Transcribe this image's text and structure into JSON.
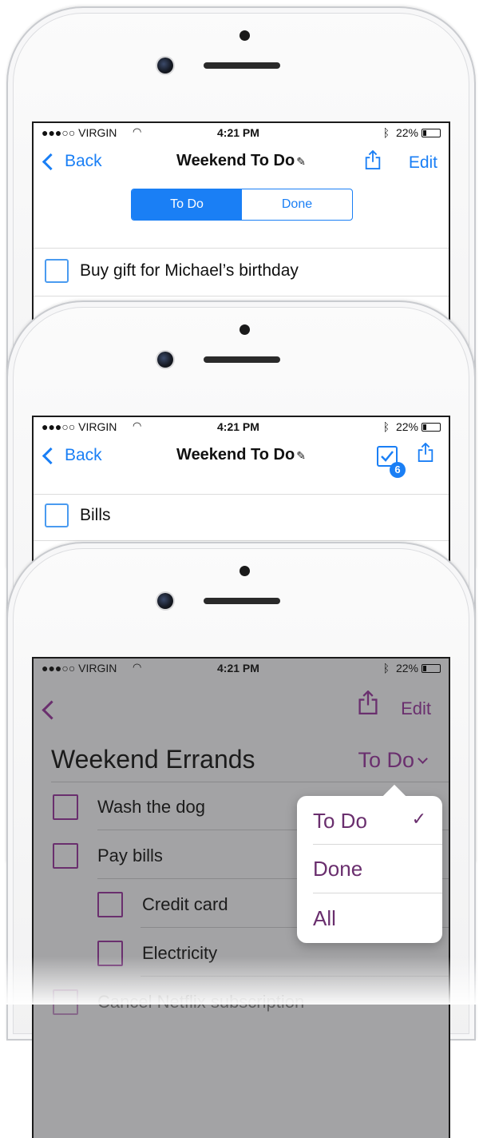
{
  "status": {
    "carrier": "●●●○○ VIRGIN",
    "time": "4:21 PM",
    "battery": "22%"
  },
  "phone1": {
    "back_label": "Back",
    "title": "Weekend To Do",
    "edit_label": "Edit",
    "segment_todo": "To Do",
    "segment_done": "Done",
    "task1": "Buy gift for Michael’s birthday"
  },
  "phone2": {
    "back_label": "Back",
    "title": "Weekend To Do",
    "badge_count": "6",
    "task1": "Bills"
  },
  "phone3": {
    "edit_label": "Edit",
    "title": "Weekend Errands",
    "filter_label": "To Do",
    "tasks": [
      "Wash the dog",
      "Pay bills",
      "Credit card",
      "Electricity",
      "Cancel Netflix subscription"
    ],
    "dropdown": {
      "todo": "To Do",
      "done": "Done",
      "all": "All",
      "check": "✓"
    }
  },
  "colors": {
    "ios_blue": "#1a7ff5",
    "accent_purple": "#6a2f6e",
    "dim_gray": "#a3a3a5"
  },
  "icons": [
    "chevron-left-icon",
    "share-icon",
    "edit-pencil-icon",
    "task-check-icon",
    "chevron-down-icon",
    "checkmark-icon",
    "wifi-icon",
    "bluetooth-icon",
    "battery-icon"
  ]
}
